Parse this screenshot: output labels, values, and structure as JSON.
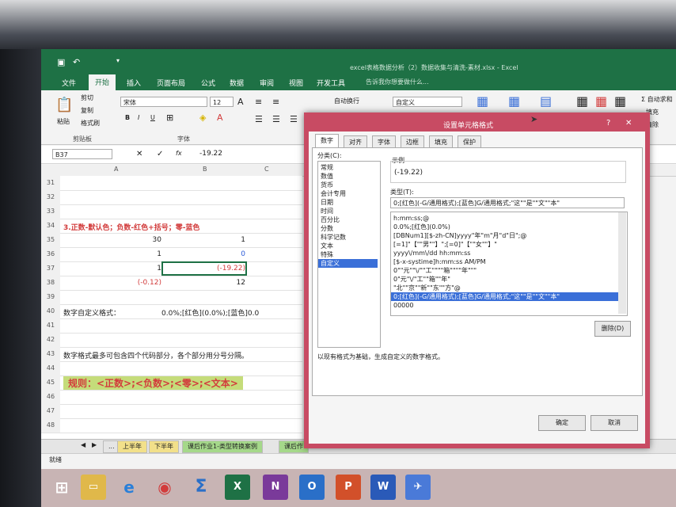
{
  "titlebar": {
    "doc_title": "excel表格数据分析（2）数据收集与清洗-素材.xlsx - Excel",
    "autosave_icon": "save-icon",
    "undo_icon": "undo-icon"
  },
  "tabs": [
    "文件",
    "开始",
    "插入",
    "页面布局",
    "公式",
    "数据",
    "审阅",
    "视图",
    "开发工具"
  ],
  "active_tab": "开始",
  "tellme": "告诉我你想要做什么...",
  "ribbon": {
    "paste": "粘贴",
    "cut": "剪切",
    "copy": "复制",
    "format_painter": "格式刷",
    "clipboard": "剪贴板",
    "font_name": "宋体",
    "font_size": "12",
    "font_group": "字体",
    "wrap_text": "自动换行",
    "number_format": "自定义",
    "autosum": "Σ 自动求和",
    "fill": "填充",
    "clear": "清除"
  },
  "formula_bar": {
    "name_box": "B37",
    "fx": "fx",
    "value": "-19.22"
  },
  "columns": [
    "A",
    "B",
    "C"
  ],
  "rows": [
    {
      "n": "31",
      "a": "",
      "b": ""
    },
    {
      "n": "32",
      "a": "",
      "b": ""
    },
    {
      "n": "33",
      "a": "",
      "b": ""
    },
    {
      "n": "34",
      "a": "3.正数-默认色；负数-红色+括号；零-蓝色",
      "b": ""
    },
    {
      "n": "35",
      "a": "30",
      "b": "1"
    },
    {
      "n": "36",
      "a": "1",
      "b": "0"
    },
    {
      "n": "37",
      "a": "1",
      "b": "(-19.22)"
    },
    {
      "n": "38",
      "a": "(-0.12)",
      "b": "12"
    },
    {
      "n": "39",
      "a": "",
      "b": ""
    },
    {
      "n": "40",
      "a": "数字自定义格式：",
      "b": "0.0%;[红色](0.0%);[蓝色]0.0"
    },
    {
      "n": "41",
      "a": "",
      "b": ""
    },
    {
      "n": "42",
      "a": "",
      "b": ""
    },
    {
      "n": "43",
      "a": "数字格式最多可包含四个代码部分，各个部分用分号分隔。",
      "b": ""
    },
    {
      "n": "44",
      "a": "",
      "b": ""
    },
    {
      "n": "45",
      "a": "规则：<正数>;<负数>;<零>;<文本>",
      "b": ""
    },
    {
      "n": "46",
      "a": "",
      "b": ""
    },
    {
      "n": "47",
      "a": "",
      "b": ""
    },
    {
      "n": "48",
      "a": "",
      "b": ""
    }
  ],
  "sheet_tabs": [
    "...",
    "上半年",
    "下半年",
    "课后作业1-类型转换案例",
    "课后作"
  ],
  "status": "就绪",
  "dialog": {
    "title": "设置单元格格式",
    "tabs": [
      "数字",
      "对齐",
      "字体",
      "边框",
      "填充",
      "保护"
    ],
    "active_tab": "数字",
    "category_label": "分类(C):",
    "categories": [
      "常规",
      "数值",
      "货币",
      "会计专用",
      "日期",
      "时间",
      "百分比",
      "分数",
      "科学记数",
      "文本",
      "特殊",
      "自定义"
    ],
    "selected_category": "自定义",
    "sample_label": "示例",
    "sample_value": "(-19.22)",
    "type_label": "类型(T):",
    "type_value": "0;[红色](-G/通用格式);[蓝色]G/通用格式;\"这\"\"是\"\"文\"\"本\"",
    "formats": [
      "h:mm:ss;@",
      "0.0%;[红色](0.0%)",
      "[DBNum1][$-zh-CN]yyyy\"年\"m\"月\"d\"日\";@",
      "[=1]\"【\"\"男\"\"】\";[=0]\"【\"\"女\"\"】\"",
      "yyyy\\/mm\\/dd hh:mm:ss",
      "[$-x-systime]h:mm:ss AM/PM",
      "0\"\"元\"\"\\/\"\"工\"\"\"\"箱\"\"\"\"年\"\"\"",
      "0\"元\"\\/\"工\"\"箱\"\"年\"",
      "\"北\"\"京\"\"新\"\"东\"\"方\"@",
      "0;[红色](-G/通用格式);[蓝色]G/通用格式;\"这\"\"是\"\"文\"\"本\"",
      "00000"
    ],
    "selected_format_index": 9,
    "delete_button": "删除(D)",
    "hint": "以现有格式为基础，生成自定义的数字格式。",
    "ok": "确定",
    "cancel": "取消",
    "help": "?",
    "close": "✕"
  },
  "taskbar": {
    "apps": [
      "windows-logo",
      "file-explorer",
      "internet-explorer",
      "chrome",
      "sigma-app",
      "excel",
      "onenote",
      "outlook",
      "powerpoint",
      "word",
      "other-app"
    ]
  },
  "colors": {
    "excel_green": "#1e7145",
    "dialog_accent": "#c84b63",
    "red_text": "#d23c3c",
    "selection": "#3a6fd8"
  }
}
